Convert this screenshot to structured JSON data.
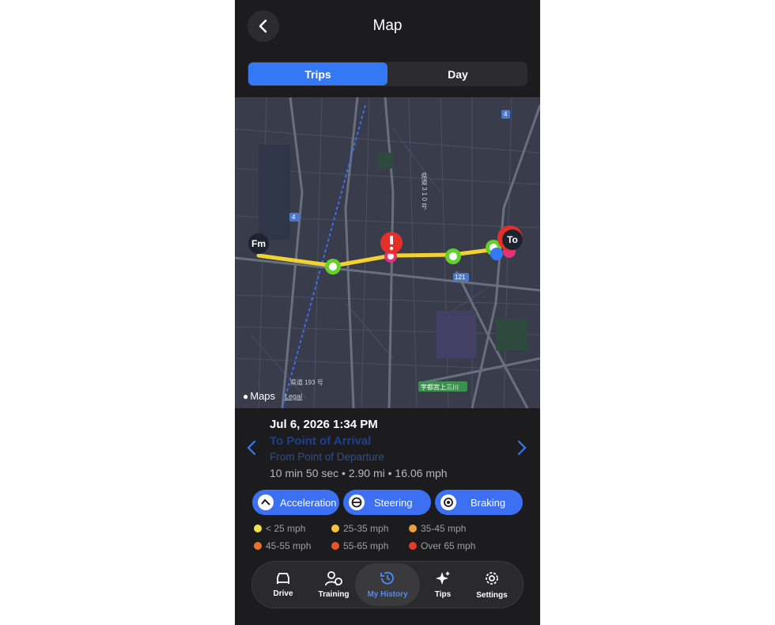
{
  "header": {
    "title": "Map",
    "back_icon": "chevron-left-icon"
  },
  "segmented": {
    "trips_label": "Trips",
    "day_label": "Day",
    "selected": "Trips"
  },
  "map": {
    "fm_label": "Fm",
    "to_label": "To",
    "brand": "Maps",
    "legal": "Legal",
    "road_labels": [
      "4",
      "4",
      "121",
      "県道 193 号",
      "宇都宮上三川",
      "県道 3 1 0 号"
    ]
  },
  "trip": {
    "date": "Jul 6, 2026 1:34 PM",
    "destination": "To Point of Arrival",
    "origin": "From Point of Departure",
    "stats": "10 min 50 sec • 2.90 mi • 16.06 mph"
  },
  "events": {
    "acceleration": "Acceleration",
    "steering": "Steering",
    "braking": "Braking"
  },
  "legend": [
    {
      "label": "< 25 mph",
      "color": "#f2e34b"
    },
    {
      "label": "25-35 mph",
      "color": "#f2c23a"
    },
    {
      "label": "35-45 mph",
      "color": "#e9a23a"
    },
    {
      "label": "45-55 mph",
      "color": "#e8752f"
    },
    {
      "label": "55-65 mph",
      "color": "#e9552a"
    },
    {
      "label": "Over 65 mph",
      "color": "#e43b24"
    }
  ],
  "tabbar": {
    "drive": "Drive",
    "training": "Training",
    "history": "My History",
    "tips": "Tips",
    "settings": "Settings",
    "active": "My History"
  },
  "colors": {
    "accent": "#3478f6",
    "route": "#f2d230",
    "event_green": "#63d02e",
    "alert_red": "#e5302a"
  }
}
